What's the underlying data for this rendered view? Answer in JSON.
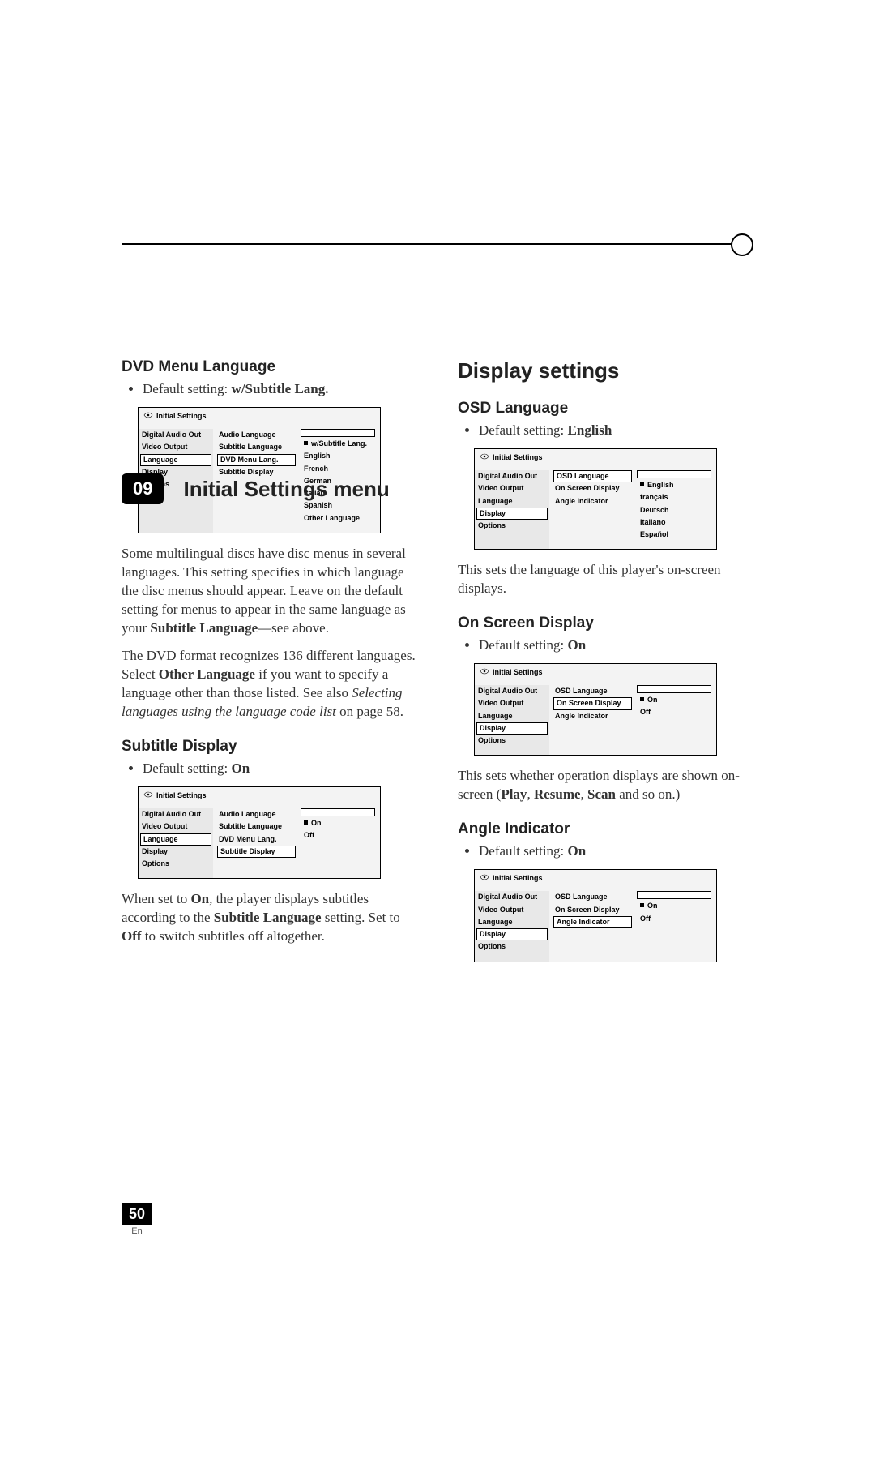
{
  "chapter": {
    "num": "09",
    "title": "Initial Settings menu"
  },
  "page": {
    "num": "50",
    "lang": "En"
  },
  "left": {
    "dvd_menu": {
      "heading": "DVD Menu Language",
      "default_label": "Default setting: ",
      "default_value": "w/Subtitle Lang.",
      "osd": {
        "title": "Initial Settings",
        "nav": [
          "Digital Audio Out",
          "Video Output",
          "Language",
          "Display",
          "Options"
        ],
        "nav_selected": 2,
        "mid": [
          "Audio Language",
          "Subtitle Language",
          "DVD Menu Lang.",
          "Subtitle Display"
        ],
        "mid_selected": 2,
        "right": [
          "w/Subtitle Lang.",
          "English",
          "French",
          "German",
          "Italian",
          "Spanish",
          "Other Language"
        ],
        "right_marked": 0
      },
      "para1a": "Some multilingual discs have disc menus in several languages. This setting specifies in which language the disc menus should appear. Leave on the default setting for menus to appear in the same language as your ",
      "para1b": "Subtitle Language",
      "para1c": "—see above.",
      "para2a": "The DVD format recognizes 136 different languages. Select ",
      "para2b": "Other Language",
      "para2c": " if you want to specify a language other than those listed. See also ",
      "para2d": "Selecting languages using the language code list",
      "para2e": " on page 58."
    },
    "subtitle_display": {
      "heading": "Subtitle Display",
      "default_label": "Default setting: ",
      "default_value": "On",
      "osd": {
        "title": "Initial Settings",
        "nav": [
          "Digital Audio Out",
          "Video Output",
          "Language",
          "Display",
          "Options"
        ],
        "nav_selected": 2,
        "mid": [
          "Audio Language",
          "Subtitle Language",
          "DVD Menu Lang.",
          "Subtitle Display"
        ],
        "mid_selected": 3,
        "right": [
          "On",
          "Off"
        ],
        "right_marked": 0
      },
      "para_a": "When set to ",
      "para_b": "On",
      "para_c": ", the player displays subtitles according to the ",
      "para_d": "Subtitle Language",
      "para_e": " setting. Set to ",
      "para_f": "Off",
      "para_g": " to switch subtitles off altogether."
    }
  },
  "right": {
    "section": "Display settings",
    "osd_language": {
      "heading": "OSD Language",
      "default_label": "Default setting: ",
      "default_value": "English",
      "osd": {
        "title": "Initial Settings",
        "nav": [
          "Digital Audio Out",
          "Video Output",
          "Language",
          "Display",
          "Options"
        ],
        "nav_selected": 3,
        "mid": [
          "OSD Language",
          "On Screen Display",
          "Angle Indicator"
        ],
        "mid_selected": 0,
        "right": [
          "English",
          "français",
          "Deutsch",
          "Italiano",
          "Español"
        ],
        "right_marked": 0
      },
      "para": "This sets the language of this player's on-screen displays."
    },
    "on_screen_display": {
      "heading": "On Screen Display",
      "default_label": "Default setting: ",
      "default_value": "On",
      "osd": {
        "title": "Initial Settings",
        "nav": [
          "Digital Audio Out",
          "Video Output",
          "Language",
          "Display",
          "Options"
        ],
        "nav_selected": 3,
        "mid": [
          "OSD Language",
          "On Screen Display",
          "Angle Indicator"
        ],
        "mid_selected": 1,
        "right": [
          "On",
          "Off"
        ],
        "right_marked": 0
      },
      "para_a": "This sets whether operation displays are shown on-screen (",
      "para_b": "Play",
      "para_c": ", ",
      "para_d": "Resume",
      "para_e": ", ",
      "para_f": "Scan",
      "para_g": " and so on.)"
    },
    "angle_indicator": {
      "heading": "Angle Indicator",
      "default_label": "Default setting: ",
      "default_value": "On",
      "osd": {
        "title": "Initial Settings",
        "nav": [
          "Digital Audio Out",
          "Video Output",
          "Language",
          "Display",
          "Options"
        ],
        "nav_selected": 3,
        "mid": [
          "OSD Language",
          "On Screen Display",
          "Angle Indicator"
        ],
        "mid_selected": 2,
        "right": [
          "On",
          "Off"
        ],
        "right_marked": 0
      }
    }
  }
}
